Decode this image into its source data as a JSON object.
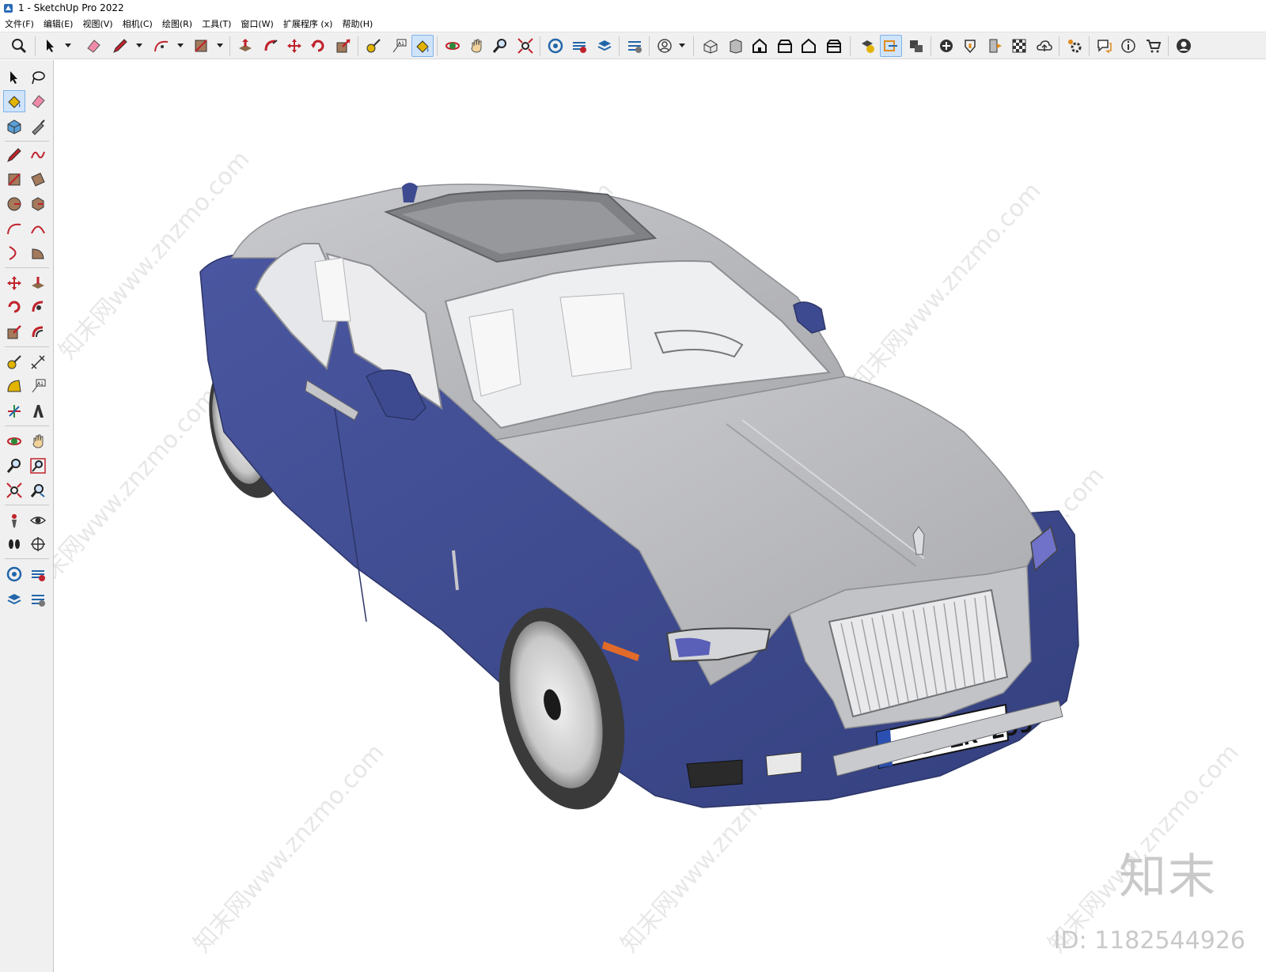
{
  "window": {
    "title": "1 - SketchUp Pro 2022"
  },
  "menu": {
    "items": [
      "文件(F)",
      "编辑(E)",
      "视图(V)",
      "相机(C)",
      "绘图(R)",
      "工具(T)",
      "窗口(W)",
      "扩展程序 (x)",
      "帮助(H)"
    ]
  },
  "toolbar": {
    "icons": [
      "zoom-icon",
      "select-icon",
      "eraser-icon",
      "pencil-icon",
      "arc-icon",
      "rectangle-icon",
      "push-pull-icon",
      "follow-me-icon",
      "move-icon",
      "rotate-icon",
      "scale-icon",
      "tape-measure-icon",
      "text-icon",
      "paint-bucket-icon",
      "orbit-icon",
      "pan-icon",
      "zoom-camera-icon",
      "zoom-extents-icon",
      "warehouse-icon",
      "extension-warehouse-icon",
      "layout-icon",
      "extension-manager-icon",
      "profile-icon",
      "iso-view-icon",
      "top-view-icon",
      "front-view-icon",
      "right-view-icon",
      "back-view-icon",
      "left-view-icon",
      "style-icon",
      "section-plane-icon",
      "section-display-icon",
      "add-location-icon",
      "shadow-icon",
      "soften-icon",
      "texture-icon",
      "cloud-icon",
      "settings-icon",
      "chat-icon",
      "info-icon",
      "cart-icon",
      "account-icon"
    ]
  },
  "viewport": {
    "plate_text": "WOB ZK 295",
    "plate_country": "D",
    "brand_mark": "知末",
    "image_id": "ID: 1182544926",
    "watermark": "知末网www.znzmo.com"
  },
  "colors": {
    "body_blue": "#3c4a8c",
    "body_silver": "#b8b9bd",
    "toolbar_bg": "#f0f0f0",
    "active_tool": "#cfe3fa"
  }
}
